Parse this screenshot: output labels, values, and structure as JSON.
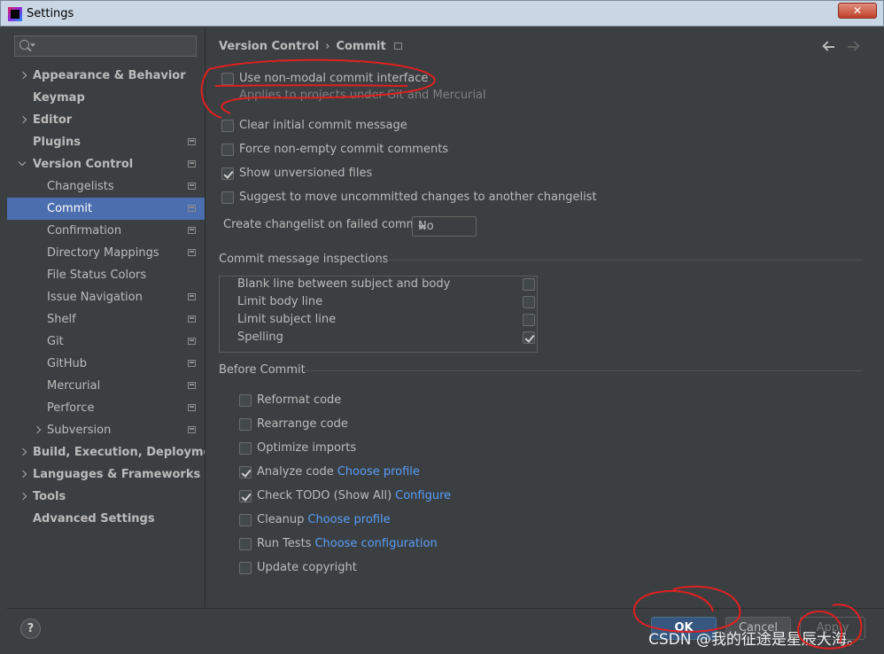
{
  "window": {
    "title": "Settings",
    "close_label": "✕"
  },
  "sidebar": {
    "search_placeholder": "",
    "items": [
      {
        "label": "Appearance & Behavior",
        "bold": true,
        "expand": "right",
        "indent": 0,
        "icon": false
      },
      {
        "label": "Keymap",
        "bold": true,
        "expand": "",
        "indent": 0,
        "icon": false
      },
      {
        "label": "Editor",
        "bold": true,
        "expand": "right",
        "indent": 0,
        "icon": false
      },
      {
        "label": "Plugins",
        "bold": true,
        "expand": "",
        "indent": 0,
        "icon": true
      },
      {
        "label": "Version Control",
        "bold": true,
        "expand": "down",
        "indent": 0,
        "icon": true
      },
      {
        "label": "Changelists",
        "bold": false,
        "expand": "",
        "indent": 1,
        "icon": true
      },
      {
        "label": "Commit",
        "bold": false,
        "expand": "",
        "indent": 1,
        "icon": true,
        "selected": true
      },
      {
        "label": "Confirmation",
        "bold": false,
        "expand": "",
        "indent": 1,
        "icon": true
      },
      {
        "label": "Directory Mappings",
        "bold": false,
        "expand": "",
        "indent": 1,
        "icon": true
      },
      {
        "label": "File Status Colors",
        "bold": false,
        "expand": "",
        "indent": 1,
        "icon": false
      },
      {
        "label": "Issue Navigation",
        "bold": false,
        "expand": "",
        "indent": 1,
        "icon": true
      },
      {
        "label": "Shelf",
        "bold": false,
        "expand": "",
        "indent": 1,
        "icon": true
      },
      {
        "label": "Git",
        "bold": false,
        "expand": "",
        "indent": 1,
        "icon": true
      },
      {
        "label": "GitHub",
        "bold": false,
        "expand": "",
        "indent": 1,
        "icon": true
      },
      {
        "label": "Mercurial",
        "bold": false,
        "expand": "",
        "indent": 1,
        "icon": true
      },
      {
        "label": "Perforce",
        "bold": false,
        "expand": "",
        "indent": 1,
        "icon": true
      },
      {
        "label": "Subversion",
        "bold": false,
        "expand": "right",
        "indent": 1,
        "icon": true
      },
      {
        "label": "Build, Execution, Deployment",
        "bold": true,
        "expand": "right",
        "indent": 0,
        "icon": false
      },
      {
        "label": "Languages & Frameworks",
        "bold": true,
        "expand": "right",
        "indent": 0,
        "icon": false
      },
      {
        "label": "Tools",
        "bold": true,
        "expand": "right",
        "indent": 0,
        "icon": false
      },
      {
        "label": "Advanced Settings",
        "bold": true,
        "expand": "",
        "indent": 0,
        "icon": false
      }
    ]
  },
  "breadcrumb": {
    "parent": "Version Control",
    "separator": "›",
    "current": "Commit"
  },
  "commit": {
    "non_modal": {
      "label": "Use non-modal commit interface",
      "checked": false
    },
    "non_modal_hint": "Applies to projects under Git and Mercurial",
    "clear_initial": {
      "label": "Clear initial commit message",
      "checked": false
    },
    "force_non_empty": {
      "label": "Force non-empty commit comments",
      "checked": false
    },
    "show_unversioned": {
      "label": "Show unversioned files",
      "checked": true
    },
    "suggest_move": {
      "label": "Suggest to move uncommitted changes to another changelist",
      "checked": false
    },
    "failed_commit_label": "Create changelist on failed commit:",
    "failed_commit_value": "No"
  },
  "inspections": {
    "title": "Commit message inspections",
    "rows": [
      {
        "label": "Blank line between subject and body",
        "checked": false
      },
      {
        "label": "Limit body line",
        "checked": false
      },
      {
        "label": "Limit subject line",
        "checked": false
      },
      {
        "label": "Spelling",
        "checked": true
      }
    ]
  },
  "before_commit": {
    "title": "Before Commit",
    "reformat": {
      "label": "Reformat code",
      "checked": false
    },
    "rearrange": {
      "label": "Rearrange code",
      "checked": false
    },
    "optimize": {
      "label": "Optimize imports",
      "checked": false
    },
    "analyze": {
      "label": "Analyze code",
      "link": "Choose profile",
      "checked": true
    },
    "todo": {
      "label": "Check TODO (Show All)",
      "link": "Configure",
      "checked": true
    },
    "cleanup": {
      "label": "Cleanup",
      "link": "Choose profile",
      "checked": false
    },
    "run_tests": {
      "label": "Run Tests",
      "link": "Choose configuration",
      "checked": false
    },
    "copyright": {
      "label": "Update copyright",
      "checked": false
    }
  },
  "buttons": {
    "help": "?",
    "ok": "OK",
    "cancel": "Cancel",
    "apply": "Apply"
  },
  "watermark": "CSDN @我的征途是星辰大海。",
  "colors": {
    "accent": "#4b6eaf",
    "link": "#589df6",
    "annotation": "#e02020"
  }
}
